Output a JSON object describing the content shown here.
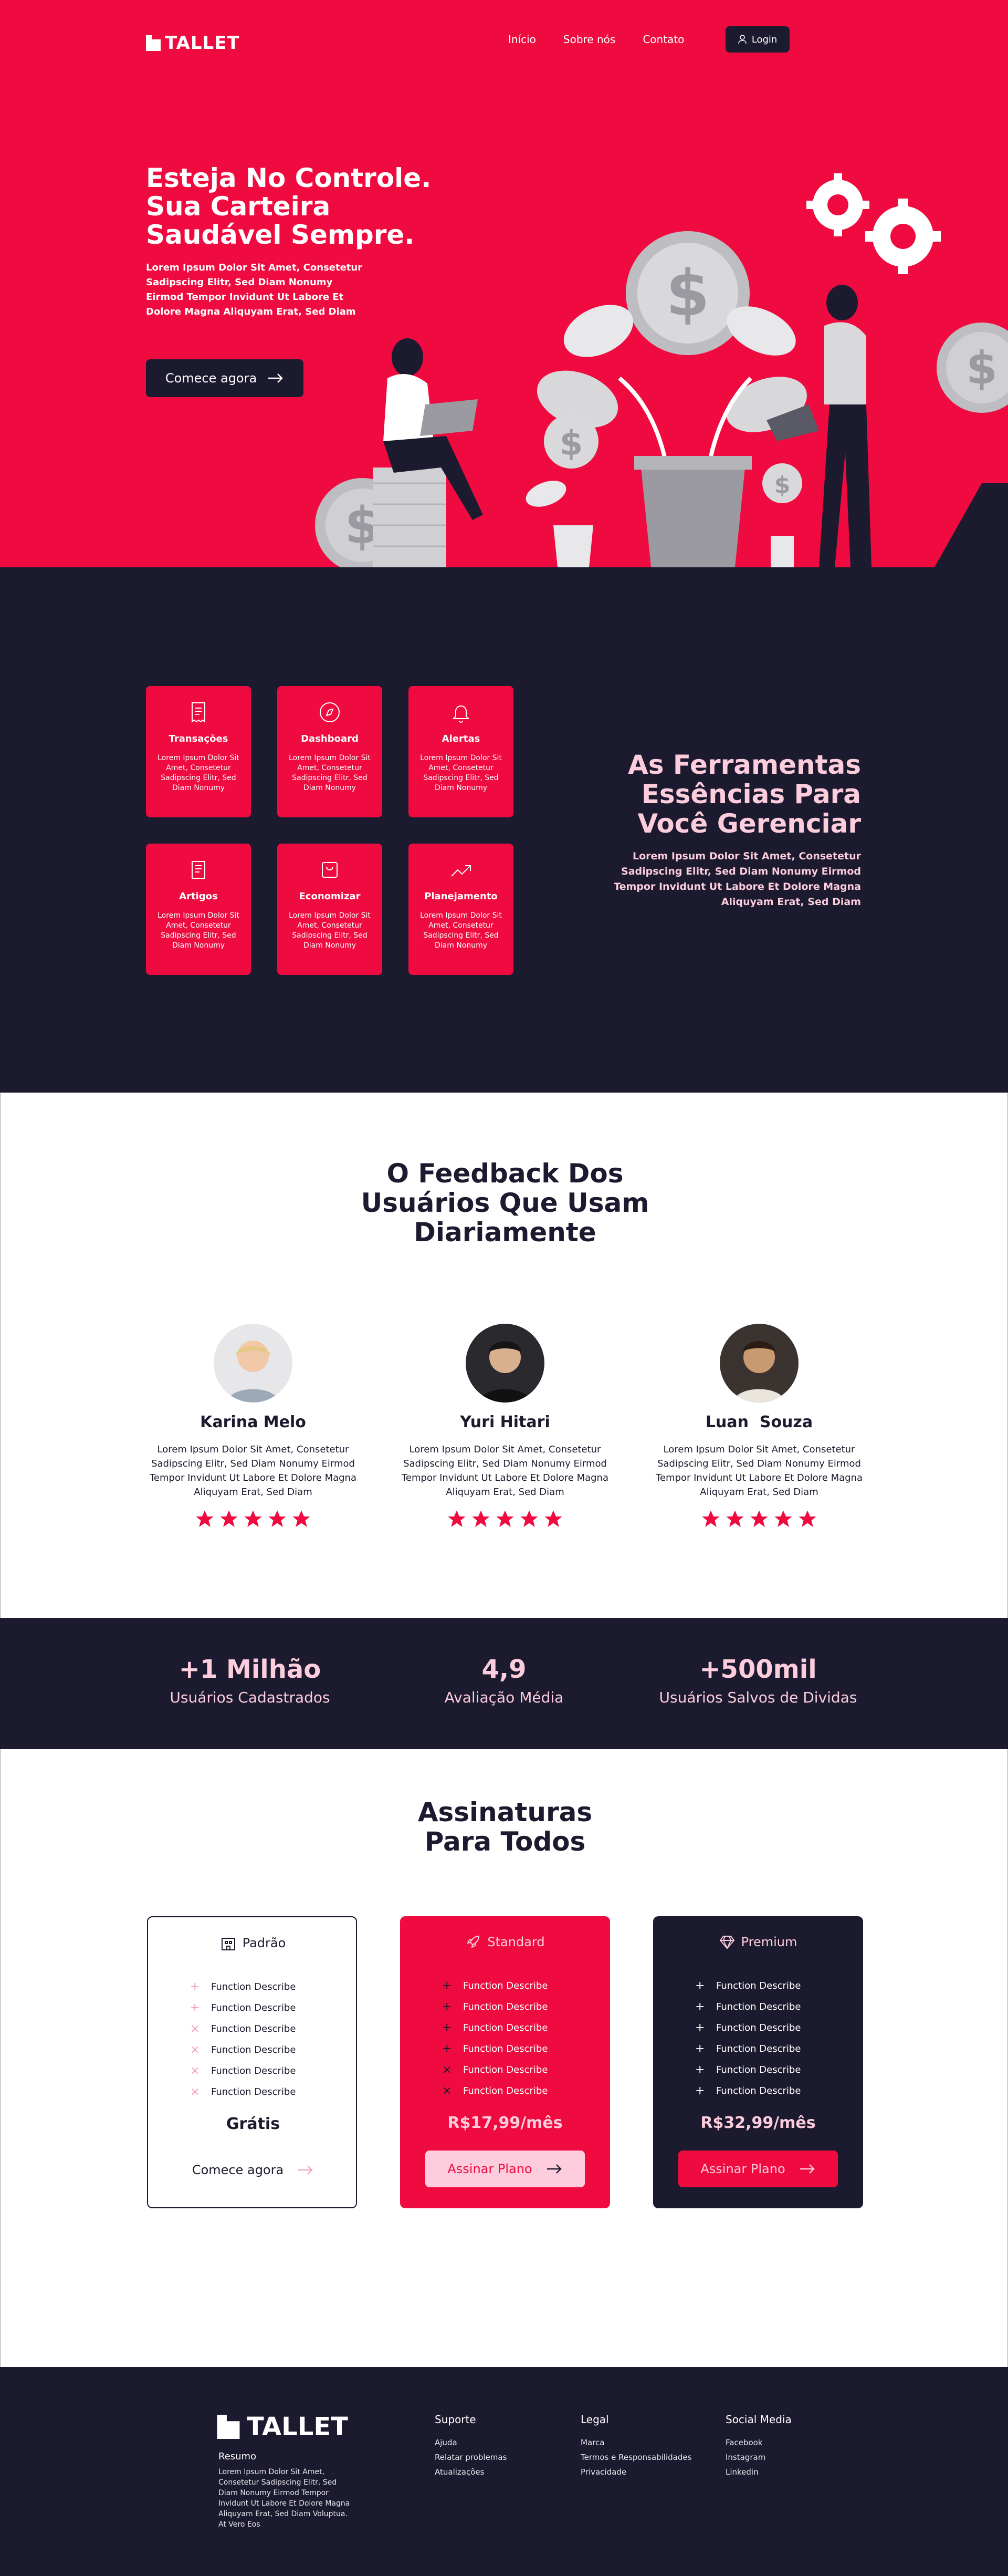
{
  "header": {
    "brand": "TALLET",
    "nav": [
      "Início",
      "Sobre nós",
      "Contato"
    ],
    "login_label": "Login"
  },
  "hero": {
    "title_lines": [
      "Esteja No Controle.",
      "Sua Carteira",
      "Saudável Sempre."
    ],
    "text": "Lorem Ipsum Dolor Sit Amet, Consetetur Sadipscing Elitr, Sed Diam Nonumy Eirmod Tempor Invidunt Ut Labore Et Dolore Magna Aliquyam Erat, Sed Diam",
    "cta_label": "Comece agora"
  },
  "tools": {
    "cards": [
      {
        "title": "Transações",
        "icon": "receipt-icon",
        "text": "Lorem Ipsum Dolor Sit Amet, Consetetur Sadipscing Elitr, Sed Diam Nonumy"
      },
      {
        "title": "Dashboard",
        "icon": "compass-icon",
        "text": "Lorem Ipsum Dolor Sit Amet, Consetetur Sadipscing Elitr, Sed Diam Nonumy"
      },
      {
        "title": "Alertas",
        "icon": "bell-icon",
        "text": "Lorem Ipsum Dolor Sit Amet, Consetetur Sadipscing Elitr, Sed Diam Nonumy"
      },
      {
        "title": "Artigos",
        "icon": "book-icon",
        "text": "Lorem Ipsum Dolor Sit Amet, Consetetur Sadipscing Elitr, Sed Diam Nonumy"
      },
      {
        "title": "Economizar",
        "icon": "bag-icon",
        "text": "Lorem Ipsum Dolor Sit Amet, Consetetur Sadipscing Elitr, Sed Diam Nonumy"
      },
      {
        "title": "Planejamento",
        "icon": "trend-up-icon",
        "text": "Lorem Ipsum Dolor Sit Amet, Consetetur Sadipscing Elitr, Sed Diam Nonumy"
      }
    ],
    "title_lines": [
      "As Ferramentas",
      "Essências Para",
      "Você Gerenciar"
    ],
    "text": "Lorem Ipsum Dolor Sit Amet, Consetetur Sadipscing Elitr, Sed Diam Nonumy Eirmod Tempor Invidunt Ut Labore Et Dolore Magna Aliquyam Erat, Sed Diam"
  },
  "feedback": {
    "title_lines": [
      "O Feedback Dos",
      "Usuários Que Usam",
      "Diariamente"
    ],
    "people": [
      {
        "name": "Karina Melo",
        "text": "Lorem Ipsum Dolor Sit Amet, Consetetur Sadipscing Elitr, Sed Diam Nonumy Eirmod Tempor Invidunt Ut Labore Et Dolore Magna Aliquyam Erat, Sed Diam",
        "rating": 5
      },
      {
        "name": "Yuri Hitari",
        "text": "Lorem Ipsum Dolor Sit Amet, Consetetur Sadipscing Elitr, Sed Diam Nonumy Eirmod Tempor Invidunt Ut Labore Et Dolore Magna Aliquyam Erat, Sed Diam",
        "rating": 5
      },
      {
        "name": "Luan  Souza",
        "text": "Lorem Ipsum Dolor Sit Amet, Consetetur Sadipscing Elitr, Sed Diam Nonumy Eirmod Tempor Invidunt Ut Labore Et Dolore Magna Aliquyam Erat, Sed Diam",
        "rating": 5
      }
    ]
  },
  "stats": [
    {
      "value": "+1 Milhão",
      "label": "Usuários Cadastrados"
    },
    {
      "value": "4,9",
      "label": "Avaliação Média"
    },
    {
      "value": "+500mil",
      "label": "Usuários Salvos de Dividas"
    }
  ],
  "pricing": {
    "title_lines": [
      "Assinaturas",
      "Para Todos"
    ],
    "plans": [
      {
        "name": "Padrão",
        "icon": "building-icon",
        "features": [
          "Function Describe",
          "Function Describe",
          "Function Describe",
          "Function Describe",
          "Function Describe",
          "Function Describe"
        ],
        "marks": [
          "plus",
          "plus",
          "cross",
          "cross",
          "cross",
          "cross"
        ],
        "price": "Grátis",
        "button": "Comece agora"
      },
      {
        "name": "Standard",
        "icon": "rocket-icon",
        "features": [
          "Function Describe",
          "Function Describe",
          "Function Describe",
          "Function Describe",
          "Function Describe",
          "Function Describe"
        ],
        "marks": [
          "plus",
          "plus",
          "plus",
          "plus",
          "cross",
          "cross"
        ],
        "price": "R$17,99/mês",
        "button": "Assinar Plano"
      },
      {
        "name": "Premium",
        "icon": "diamond-icon",
        "features": [
          "Function Describe",
          "Function Describe",
          "Function Describe",
          "Function Describe",
          "Function Describe",
          "Function Describe"
        ],
        "marks": [
          "plus",
          "plus",
          "plus",
          "plus",
          "plus",
          "plus"
        ],
        "price": "R$32,99/mês",
        "button": "Assinar Plano"
      }
    ]
  },
  "footer": {
    "brand": "TALLET",
    "resumo_title": "Resumo",
    "resumo_text": "Lorem Ipsum Dolor Sit Amet, Consetetur Sadipscing Elitr, Sed Diam Nonumy Eirmod Tempor Invidunt Ut Labore Et Dolore Magna Aliquyam Erat, Sed Diam Voluptua. At Vero Eos",
    "columns": [
      {
        "title": "Suporte",
        "links": [
          "Ajuda",
          "Relatar problemas",
          "Atualizações"
        ]
      },
      {
        "title": "Legal",
        "links": [
          "Marca",
          "Termos e Responsabilidades",
          "Privacidade"
        ]
      },
      {
        "title": "Social Media",
        "links": [
          "Facebook",
          "Instagram",
          "Linkedin"
        ]
      }
    ]
  },
  "colors": {
    "brand_red": "#ef0b3f",
    "navy": "#1b1a2e",
    "pink": "#fdcddd"
  }
}
